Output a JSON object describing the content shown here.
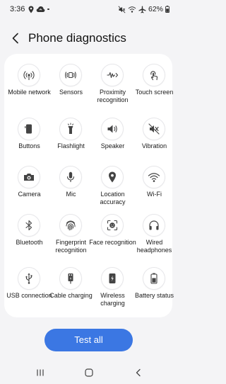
{
  "status_bar": {
    "time": "3:36",
    "battery": "62%"
  },
  "header": {
    "title": "Phone diagnostics"
  },
  "tests": [
    {
      "label": "Mobile network",
      "icon": "mobile-network-icon"
    },
    {
      "label": "Sensors",
      "icon": "sensors-icon"
    },
    {
      "label": "Proximity recognition",
      "icon": "proximity-icon"
    },
    {
      "label": "Touch screen",
      "icon": "touch-screen-icon"
    },
    {
      "label": "Buttons",
      "icon": "buttons-icon"
    },
    {
      "label": "Flashlight",
      "icon": "flashlight-icon"
    },
    {
      "label": "Speaker",
      "icon": "speaker-icon"
    },
    {
      "label": "Vibration",
      "icon": "vibration-icon"
    },
    {
      "label": "Camera",
      "icon": "camera-icon"
    },
    {
      "label": "Mic",
      "icon": "mic-icon"
    },
    {
      "label": "Location accuracy",
      "icon": "location-icon"
    },
    {
      "label": "Wi-Fi",
      "icon": "wifi-icon"
    },
    {
      "label": "Bluetooth",
      "icon": "bluetooth-icon"
    },
    {
      "label": "Fingerprint recognition",
      "icon": "fingerprint-icon"
    },
    {
      "label": "Face recognition",
      "icon": "face-recognition-icon"
    },
    {
      "label": "Wired headphones",
      "icon": "headphones-icon"
    },
    {
      "label": "USB connection",
      "icon": "usb-icon"
    },
    {
      "label": "Cable charging",
      "icon": "cable-charging-icon"
    },
    {
      "label": "Wireless charging",
      "icon": "wireless-charging-icon"
    },
    {
      "label": "Battery status",
      "icon": "battery-status-icon"
    }
  ],
  "actions": {
    "test_all": "Test all"
  },
  "colors": {
    "accent": "#3b77e3",
    "background": "#f4f4f6",
    "panel": "#ffffff",
    "icon_stroke": "#444444"
  }
}
